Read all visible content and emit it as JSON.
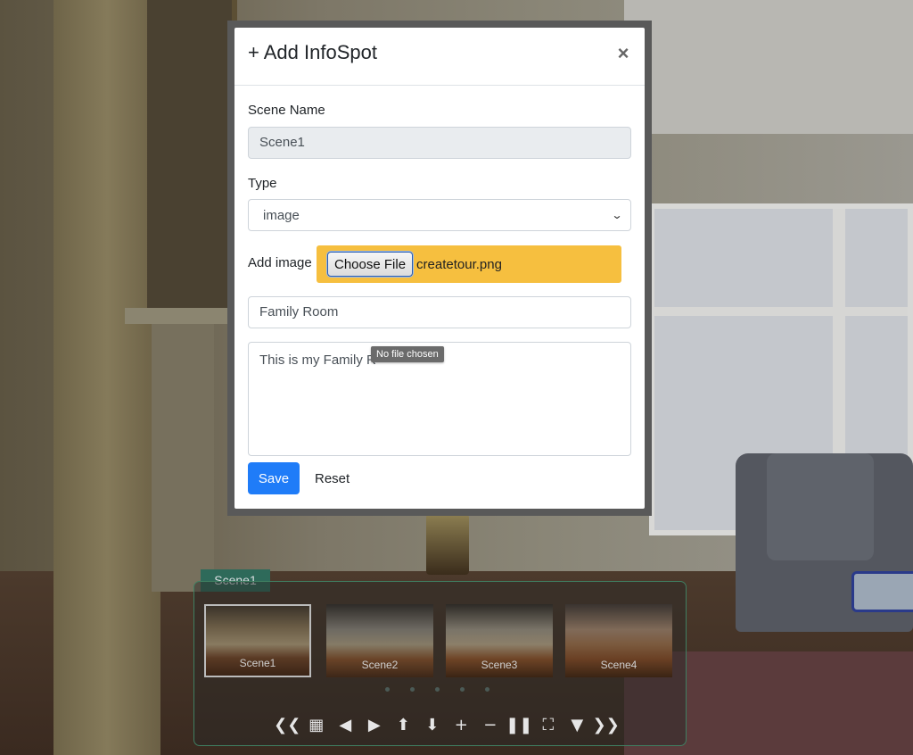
{
  "modal": {
    "title": "+ Add InfoSpot",
    "close_label": "×",
    "scene_name_label": "Scene Name",
    "scene_name_value": "Scene1",
    "type_label": "Type",
    "type_value": "image",
    "add_image_label": "Add image",
    "choose_file_label": "Choose File",
    "file_name": "createtour.png",
    "title_field_value": "Family Room",
    "description_value": "This is my Family R",
    "tooltip": "No file chosen",
    "save_label": "Save",
    "reset_label": "Reset"
  },
  "scene_bar": {
    "current_scene": "Scene1",
    "thumbnails": [
      {
        "label": "Scene1",
        "active": true
      },
      {
        "label": "Scene2",
        "active": false
      },
      {
        "label": "Scene3",
        "active": false
      },
      {
        "label": "Scene4",
        "active": false
      }
    ],
    "page_dots": 5,
    "controls": [
      {
        "name": "prev-page-icon",
        "glyph": "❮❮"
      },
      {
        "name": "grid-icon",
        "glyph": "▦"
      },
      {
        "name": "left-icon",
        "glyph": "◀"
      },
      {
        "name": "right-icon",
        "glyph": "▶"
      },
      {
        "name": "up-icon",
        "glyph": "⬆"
      },
      {
        "name": "down-icon",
        "glyph": "⬇"
      },
      {
        "name": "zoom-in-icon",
        "glyph": "+"
      },
      {
        "name": "zoom-out-icon",
        "glyph": "−"
      },
      {
        "name": "pause-icon",
        "glyph": "❚❚"
      },
      {
        "name": "fullscreen-icon",
        "glyph": "⛶"
      },
      {
        "name": "toggle-bar-icon",
        "glyph": "▼"
      },
      {
        "name": "next-page-icon",
        "glyph": "❯❯"
      }
    ]
  },
  "colors": {
    "save_button": "#1f7cf8",
    "file_highlight": "#f6bf3f",
    "scene_tag": "#2e6a5a",
    "panel_border": "#3f7e61"
  }
}
